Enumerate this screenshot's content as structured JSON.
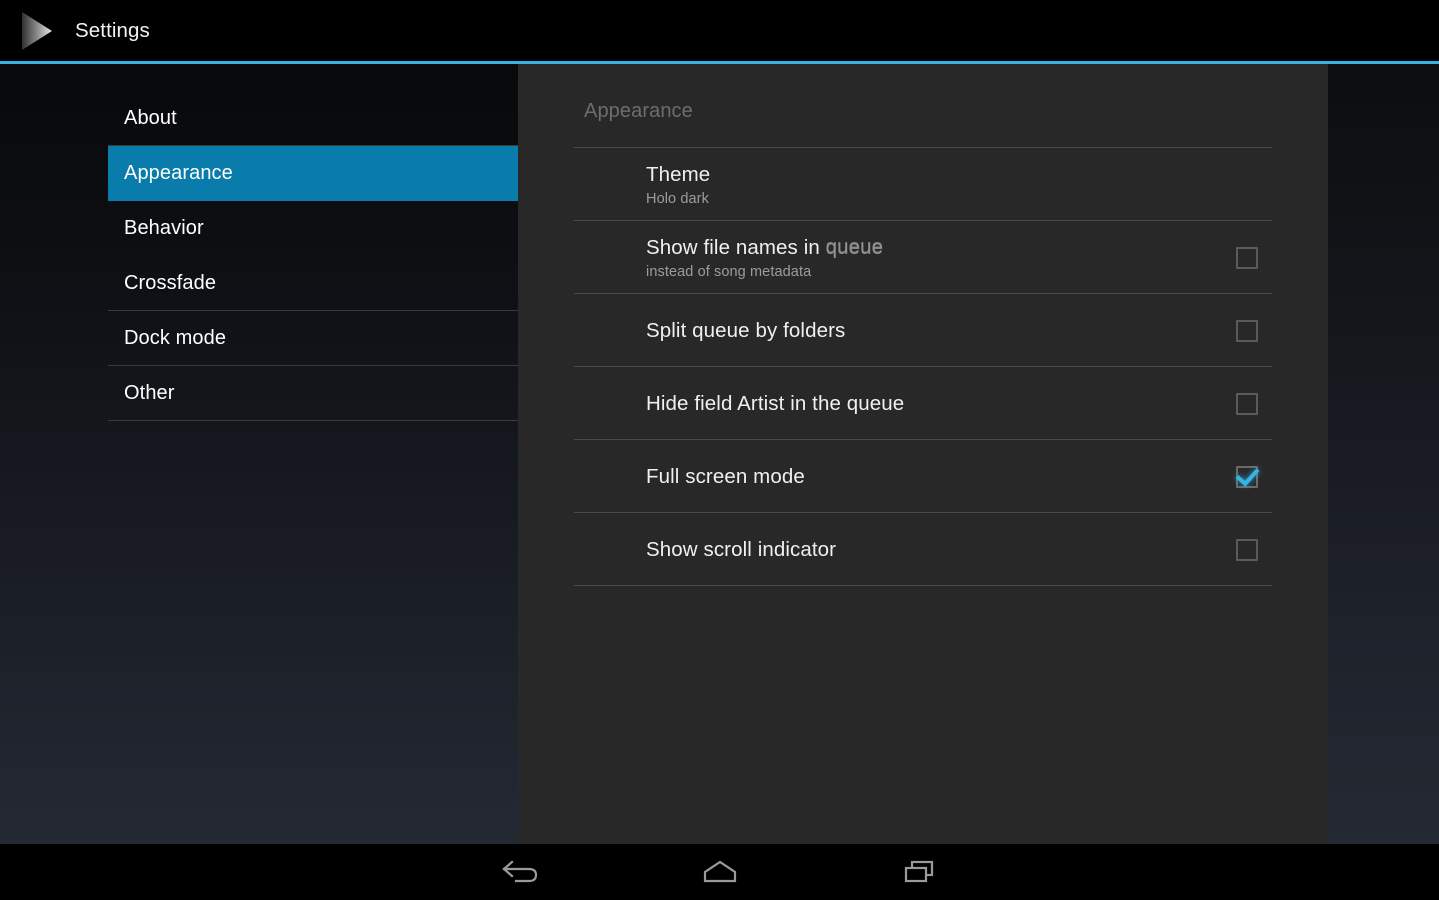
{
  "action_bar": {
    "icon": "play-triangle-icon",
    "title": "Settings"
  },
  "accent_color": "#33b5e5",
  "selected_color": "#0a7cab",
  "nav_pane": {
    "items": [
      {
        "label": "About",
        "selected": false
      },
      {
        "label": "Appearance",
        "selected": true
      },
      {
        "label": "Behavior",
        "selected": false
      },
      {
        "label": "Crossfade",
        "selected": false
      },
      {
        "label": "Dock mode",
        "selected": false
      },
      {
        "label": "Other",
        "selected": false
      }
    ]
  },
  "pref_panel": {
    "header": "Appearance",
    "rows": [
      {
        "title": "Theme",
        "subtitle": "Holo dark",
        "has_checkbox": false,
        "checked": false
      },
      {
        "title_a": "Show file names in ",
        "title_b": "queue",
        "subtitle": "instead of song metadata",
        "has_checkbox": true,
        "checked": false
      },
      {
        "title": "Split queue by folders",
        "subtitle": "",
        "has_checkbox": true,
        "checked": false
      },
      {
        "title": "Hide field Artist in the queue",
        "subtitle": "",
        "has_checkbox": true,
        "checked": false
      },
      {
        "title": "Full screen mode",
        "subtitle": "",
        "has_checkbox": true,
        "checked": true
      },
      {
        "title": "Show scroll indicator",
        "subtitle": "",
        "has_checkbox": true,
        "checked": false
      }
    ]
  },
  "system_nav": {
    "back": "back-icon",
    "home": "home-icon",
    "recents": "recents-icon"
  }
}
